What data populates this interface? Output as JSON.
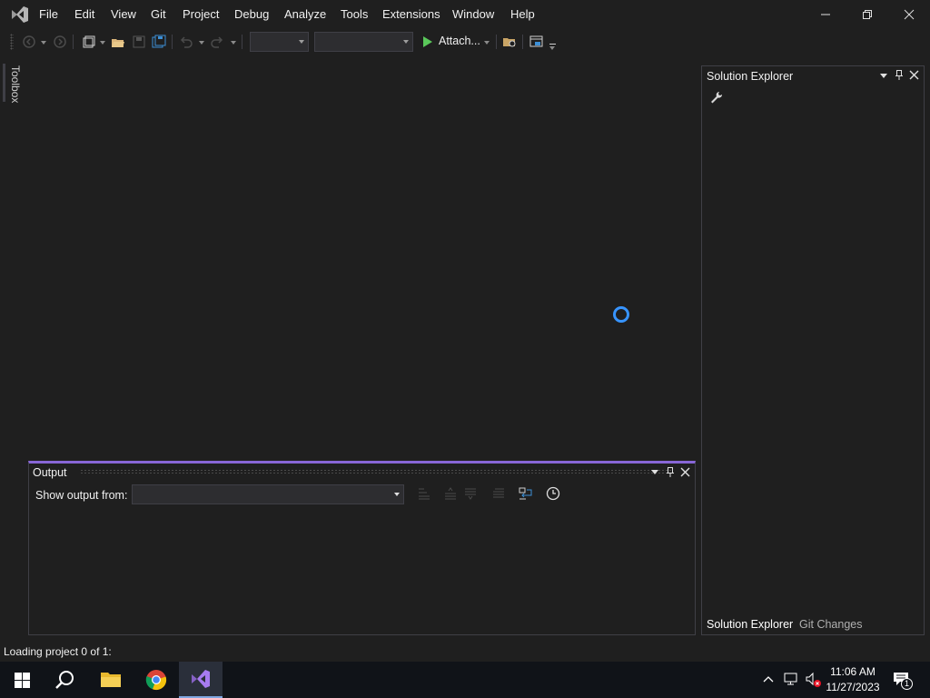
{
  "titlebar": {
    "menu": [
      {
        "name": "menu-file",
        "label": "File"
      },
      {
        "name": "menu-edit",
        "label": "Edit"
      },
      {
        "name": "menu-view",
        "label": "View"
      },
      {
        "name": "menu-git",
        "label": "Git"
      },
      {
        "name": "menu-project",
        "label": "Project"
      },
      {
        "name": "menu-debug",
        "label": "Debug"
      },
      {
        "name": "menu-analyze",
        "label": "Analyze"
      },
      {
        "name": "menu-tools",
        "label": "Tools"
      },
      {
        "name": "menu-extensions",
        "label": "Extensions"
      },
      {
        "name": "menu-window",
        "label": "Window"
      },
      {
        "name": "menu-help",
        "label": "Help"
      }
    ]
  },
  "toolbar": {
    "attach_label": "Attach...",
    "config_value": "",
    "platform_value": ""
  },
  "toolbox": {
    "label": "Toolbox"
  },
  "output": {
    "title": "Output",
    "show_from_label": "Show output from:",
    "show_from_value": ""
  },
  "solution_explorer": {
    "title": "Solution Explorer",
    "tabs": [
      "Solution Explorer",
      "Git Changes"
    ]
  },
  "status": {
    "text": "Loading project 0 of 1:"
  },
  "taskbar": {
    "time": "11:06 AM",
    "date": "11/27/2023",
    "notification_count": "1"
  },
  "colors": {
    "accent": "#8866d6",
    "spinner": "#3794ff",
    "run": "#5ac85a",
    "background": "#1f1f1f",
    "taskbar": "#101318"
  }
}
